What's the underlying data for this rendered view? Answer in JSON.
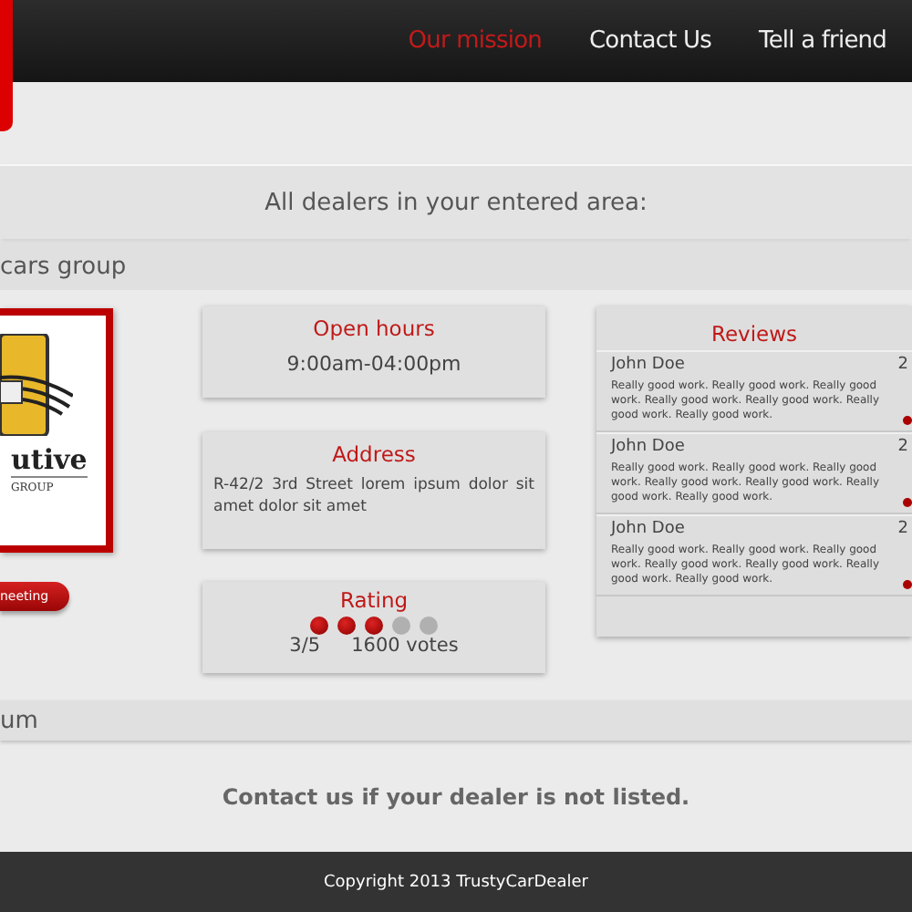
{
  "nav": [
    {
      "label": "Our mission",
      "selected": true
    },
    {
      "label": "Contact Us",
      "selected": false
    },
    {
      "label": "Tell a friend",
      "selected": false
    }
  ],
  "heading": "All dealers in your entered area:",
  "dealer": {
    "name": "cars group",
    "logo_word": "utive",
    "logo_sub": "GROUP",
    "button": "neeting",
    "hours": {
      "title": "Open hours",
      "value": "9:00am-04:00pm"
    },
    "address": {
      "title": "Address",
      "value": "R-42/2 3rd Street lorem ipsum dolor sit amet dolor sit amet"
    },
    "rating": {
      "title": "Rating",
      "stars": 3,
      "score": "3/5",
      "votes": "1600 votes"
    },
    "reviews": {
      "title": "Reviews",
      "items": [
        {
          "author": "John Doe",
          "date": "2",
          "text": "Really good work. Really good work. Really good work. Really good work. Really good work. Really good work. Really good work."
        },
        {
          "author": "John Doe",
          "date": "2",
          "text": "Really good work. Really good work. Really good work. Really good work. Really good work. Really good work. Really good work."
        },
        {
          "author": "John Doe",
          "date": "2",
          "text": "Really good work. Really good work. Really good work. Really good work. Really good work. Really good work. Really good work."
        }
      ]
    }
  },
  "next_dealer": "um",
  "contact_note": "Contact us if your dealer is not listed.",
  "footer": "Copyright 2013 TrustyCarDealer"
}
